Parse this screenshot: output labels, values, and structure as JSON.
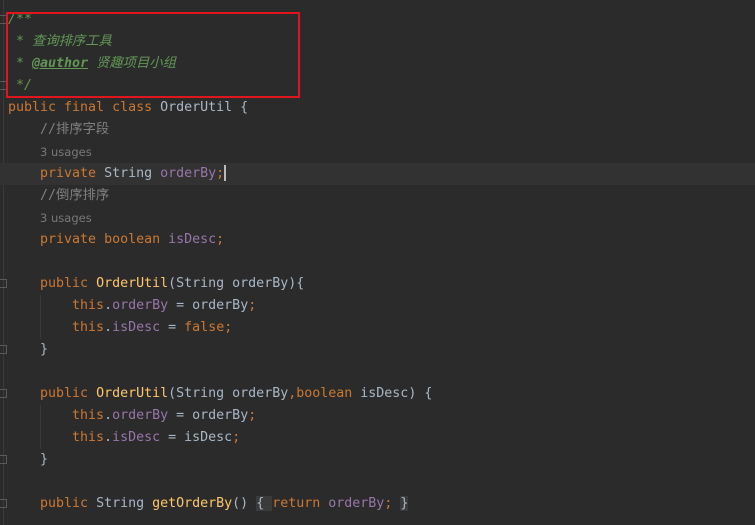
{
  "editor": {
    "current_line": 7,
    "lines": [
      {
        "tokens": [
          {
            "t": "/**",
            "c": "doc"
          }
        ]
      },
      {
        "tokens": [
          {
            "t": " * 查询排序工具",
            "c": "doc"
          }
        ]
      },
      {
        "tokens": [
          {
            "t": " * ",
            "c": "doc"
          },
          {
            "t": "@author",
            "c": "doctag"
          },
          {
            "t": " 贤趣项目小组",
            "c": "doc"
          }
        ]
      },
      {
        "tokens": [
          {
            "t": " */",
            "c": "doc"
          }
        ]
      },
      {
        "tokens": [
          {
            "t": "public final class ",
            "c": "kw"
          },
          {
            "t": "OrderUtil {",
            "c": "plain"
          }
        ]
      },
      {
        "tokens": [
          {
            "t": "    //排序字段",
            "c": "cmt"
          }
        ]
      },
      {
        "hint": "3 usages"
      },
      {
        "tokens": [
          {
            "t": "    private ",
            "c": "kw"
          },
          {
            "t": "String ",
            "c": "plain"
          },
          {
            "t": "orderBy",
            "c": "field"
          },
          {
            "t": ";",
            "c": "kw"
          }
        ],
        "caret": true
      },
      {
        "tokens": [
          {
            "t": "    //倒序排序",
            "c": "cmt"
          }
        ]
      },
      {
        "hint": "3 usages"
      },
      {
        "tokens": [
          {
            "t": "    private boolean ",
            "c": "kw"
          },
          {
            "t": "isDesc",
            "c": "field"
          },
          {
            "t": ";",
            "c": "kw"
          }
        ]
      },
      {
        "tokens": []
      },
      {
        "tokens": [
          {
            "t": "    public ",
            "c": "kw"
          },
          {
            "t": "OrderUtil",
            "c": "method"
          },
          {
            "t": "(String orderBy){",
            "c": "plain"
          }
        ]
      },
      {
        "tokens": [
          {
            "t": "        this",
            "c": "kw"
          },
          {
            "t": ".",
            "c": "plain"
          },
          {
            "t": "orderBy",
            "c": "field"
          },
          {
            "t": " = orderBy",
            "c": "plain"
          },
          {
            "t": ";",
            "c": "kw"
          }
        ]
      },
      {
        "tokens": [
          {
            "t": "        this",
            "c": "kw"
          },
          {
            "t": ".",
            "c": "plain"
          },
          {
            "t": "isDesc",
            "c": "field"
          },
          {
            "t": " = ",
            "c": "plain"
          },
          {
            "t": "false;",
            "c": "kw"
          }
        ]
      },
      {
        "tokens": [
          {
            "t": "    }",
            "c": "plain"
          }
        ]
      },
      {
        "tokens": []
      },
      {
        "tokens": [
          {
            "t": "    public ",
            "c": "kw"
          },
          {
            "t": "OrderUtil",
            "c": "method"
          },
          {
            "t": "(String orderBy",
            "c": "plain"
          },
          {
            "t": ",boolean ",
            "c": "kw"
          },
          {
            "t": "isDesc) {",
            "c": "plain"
          }
        ]
      },
      {
        "tokens": [
          {
            "t": "        this",
            "c": "kw"
          },
          {
            "t": ".",
            "c": "plain"
          },
          {
            "t": "orderBy",
            "c": "field"
          },
          {
            "t": " = orderBy",
            "c": "plain"
          },
          {
            "t": ";",
            "c": "kw"
          }
        ]
      },
      {
        "tokens": [
          {
            "t": "        this",
            "c": "kw"
          },
          {
            "t": ".",
            "c": "plain"
          },
          {
            "t": "isDesc",
            "c": "field"
          },
          {
            "t": " = isDesc",
            "c": "plain"
          },
          {
            "t": ";",
            "c": "kw"
          }
        ]
      },
      {
        "tokens": [
          {
            "t": "    }",
            "c": "plain"
          }
        ]
      },
      {
        "tokens": []
      },
      {
        "tokens": [
          {
            "t": "    public ",
            "c": "kw"
          },
          {
            "t": "String ",
            "c": "plain"
          },
          {
            "t": "getOrderBy",
            "c": "method"
          },
          {
            "t": "() ",
            "c": "plain"
          },
          {
            "t": "{ ",
            "c": "fold"
          },
          {
            "t": "return ",
            "c": "kw"
          },
          {
            "t": "orderBy",
            "c": "field"
          },
          {
            "t": "; ",
            "c": "kw"
          },
          {
            "t": "}",
            "c": "fold"
          }
        ]
      }
    ]
  }
}
